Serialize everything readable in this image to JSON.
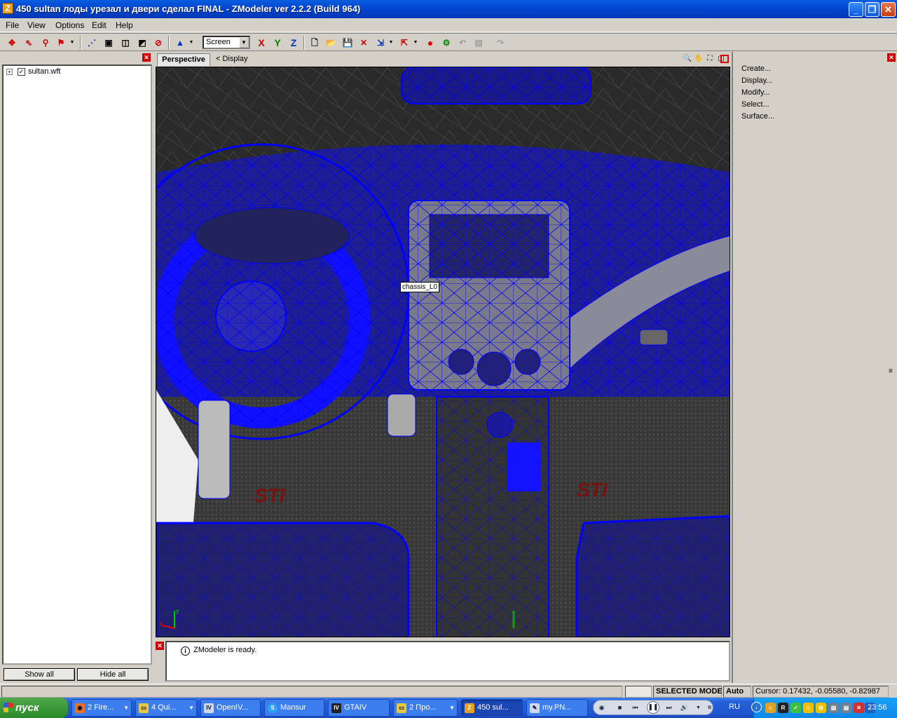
{
  "window": {
    "title": "450 sultan лоды урезал и двери сделал FINAL - ZModeler ver 2.2.2 (Build 964)",
    "app_icon_letter": "Z"
  },
  "menu": [
    "File",
    "View",
    "Options",
    "Edit",
    "Help"
  ],
  "toolbar": {
    "coord_system": "Screen",
    "axis_x": "X",
    "axis_y": "Y",
    "axis_z": "Z"
  },
  "scene_tree": {
    "root": "sultan.wft",
    "checked": true
  },
  "left_panel": {
    "show_all": "Show all",
    "hide_all": "Hide all"
  },
  "viewport": {
    "tab": "Perspective",
    "crumb": "<  Display",
    "object_label": "chassis_L0",
    "axis_y_label": "y",
    "axis_x_label": "x",
    "stamp_left": "STI",
    "stamp_right": "STI"
  },
  "command_panel": [
    "Create...",
    "Display...",
    "Modify...",
    "Select...",
    "Surface..."
  ],
  "log": {
    "message": "ZModeler is ready."
  },
  "status": {
    "mode": "SELECTED MODE",
    "snap": "Auto",
    "cursor": "Cursor: 0.17432, -0.05580, -0.82987"
  },
  "taskbar": {
    "start": "пуск",
    "tasks": [
      {
        "label": "2 Fire...",
        "icon": "firefox-icon"
      },
      {
        "label": "4 Qui...",
        "icon": "folder-icon"
      },
      {
        "label": "OpenIV...",
        "icon": "openiv-icon"
      },
      {
        "label": "Mansur",
        "icon": "skype-icon"
      },
      {
        "label": "GTAIV",
        "icon": "gtaiv-icon"
      },
      {
        "label": "2 Про...",
        "icon": "folder-icon"
      },
      {
        "label": "450 sul...",
        "icon": "zmodeler-icon"
      },
      {
        "label": "my.PN...",
        "icon": "paint-icon"
      }
    ],
    "lang": "RU",
    "clock": "23:56"
  }
}
